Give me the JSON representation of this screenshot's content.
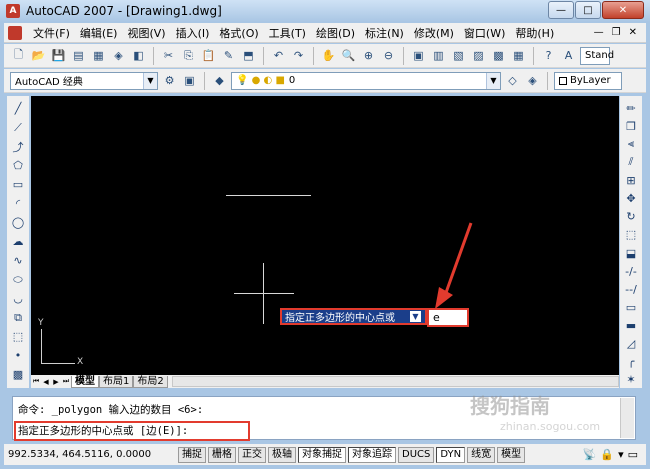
{
  "window": {
    "title": "AutoCAD 2007 - [Drawing1.dwg]",
    "controls": [
      "—",
      "□",
      "✕"
    ]
  },
  "menu": {
    "items": [
      "文件(F)",
      "编辑(E)",
      "视图(V)",
      "插入(I)",
      "格式(O)",
      "工具(T)",
      "绘图(D)",
      "标注(N)",
      "修改(M)",
      "窗口(W)",
      "帮助(H)"
    ]
  },
  "toolbar2": {
    "workspace": "AutoCAD 经典",
    "layer": "0",
    "color": "ByLayer",
    "text_style": "Stand"
  },
  "drawing": {
    "ucs_y": "Y",
    "ucs_x": "X",
    "dyn_prompt": "指定正多边形的中心点或",
    "dyn_input": "e"
  },
  "layout_tabs": [
    "模型",
    "布局1",
    "布局2"
  ],
  "command_line": {
    "line1": "命令: _polygon 输入边的数目 <6>:",
    "line2": "指定正多边形的中心点或 [边(E)]:"
  },
  "status": {
    "coords": "992.5334,  464.5116, 0.0000",
    "buttons": [
      "捕捉",
      "栅格",
      "正交",
      "极轴",
      "对象捕捉",
      "对象追踪",
      "DUCS",
      "DYN",
      "线宽",
      "模型"
    ]
  },
  "watermark": {
    "brand": "搜狗指南",
    "url": "zhinan.sogou.com"
  },
  "colors": {
    "canvas": "#000000",
    "highlight": "#e23b2e",
    "prompt_bg": "#1b3e8a"
  }
}
